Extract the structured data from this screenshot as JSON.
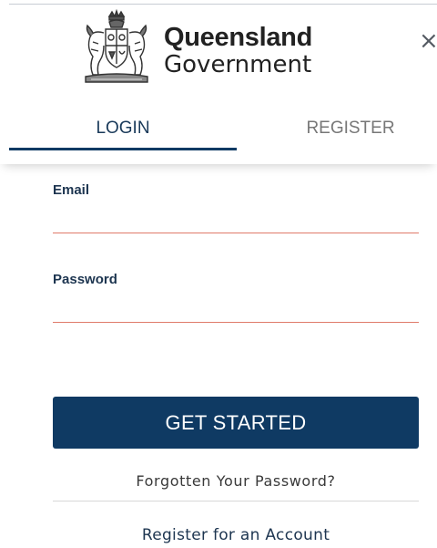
{
  "header": {
    "logo_line1": "Queensland",
    "logo_line2": "Government",
    "close_glyph": "×",
    "crest_icon": "queensland-coat-of-arms-icon"
  },
  "tabs": [
    {
      "label": "LOGIN",
      "active": true
    },
    {
      "label": "REGISTER",
      "active": false
    }
  ],
  "form": {
    "email": {
      "label": "Email",
      "value": "",
      "placeholder": ""
    },
    "password": {
      "label": "Password",
      "value": "",
      "placeholder": ""
    }
  },
  "actions": {
    "submit_label": "GET STARTED",
    "forgot_label": "Forgotten Your Password?",
    "register_label": "Register for an Account"
  },
  "colors": {
    "primary": "#0f3a63",
    "input_underline": "#e07a6a",
    "label": "#1d3550",
    "inactive_tab": "#777777"
  }
}
